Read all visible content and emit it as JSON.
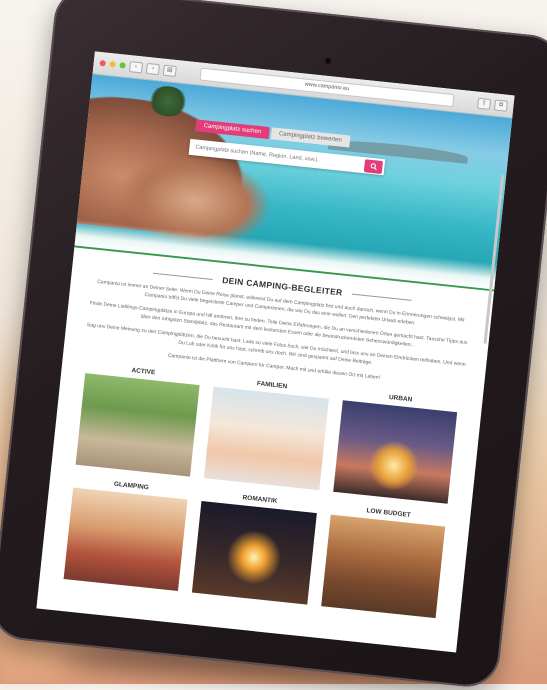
{
  "browser": {
    "url": "www.campanio.eu"
  },
  "hero": {
    "tabs": [
      {
        "label": "Campingplatz suchen",
        "active": true
      },
      {
        "label": "Campingplatz bewerten",
        "active": false
      }
    ],
    "search_placeholder": "Campingplatz suchen (Name, Region, Land, usw.)",
    "search_icon": "magnifier-icon"
  },
  "intro": {
    "heading": "DEIN CAMPING-BEGLEITER",
    "paragraphs": [
      "Campanio ist immer an Deiner Seite: Wenn Du Deine Reise planst, während Du auf dem Campingplatz bist und auch danach, wenn Du in Erinnerungen schwelgst. Mit Campanio triffst Du viele begeisterte Camper und Camperinnen, die wie Du das eine wollen: Den perfekten Urlaub erleben.",
      "Finde Deine Lieblings-Campingplätze in Europa und hilf anderen, ihre zu finden. Teile Deine Erfahrungen, die Du an verschiedenen Orten gemacht hast. Tausche Tipps aus über den ruhigsten Standplatz, das Restaurant mit dem leckersten Essen oder die beeindruckendsten Sehenswürdigkeiten...",
      "Sag uns Deine Meinung zu den Campingplätzen, die Du besucht hast. Lade so viele Fotos hoch, wie Du möchtest, und lass uns an Deinen Eindrücken teilhaben. Und wenn Du Lob oder Kritik für uns hast, schreib uns doch. Wir sind gespannt auf Deine Beiträge.",
      "Campanio ist die Plattform von Campern für Camper. Mach mit und erfülle diesen Ort mit Leben!"
    ]
  },
  "categories": [
    {
      "label": "ACTIVE"
    },
    {
      "label": "FAMILIEN"
    },
    {
      "label": "URBAN"
    },
    {
      "label": "GLAMPING"
    },
    {
      "label": "ROMANTIK"
    },
    {
      "label": "LOW BUDGET"
    }
  ],
  "colors": {
    "accent": "#e23d7a",
    "divider": "#3a9a4a"
  }
}
